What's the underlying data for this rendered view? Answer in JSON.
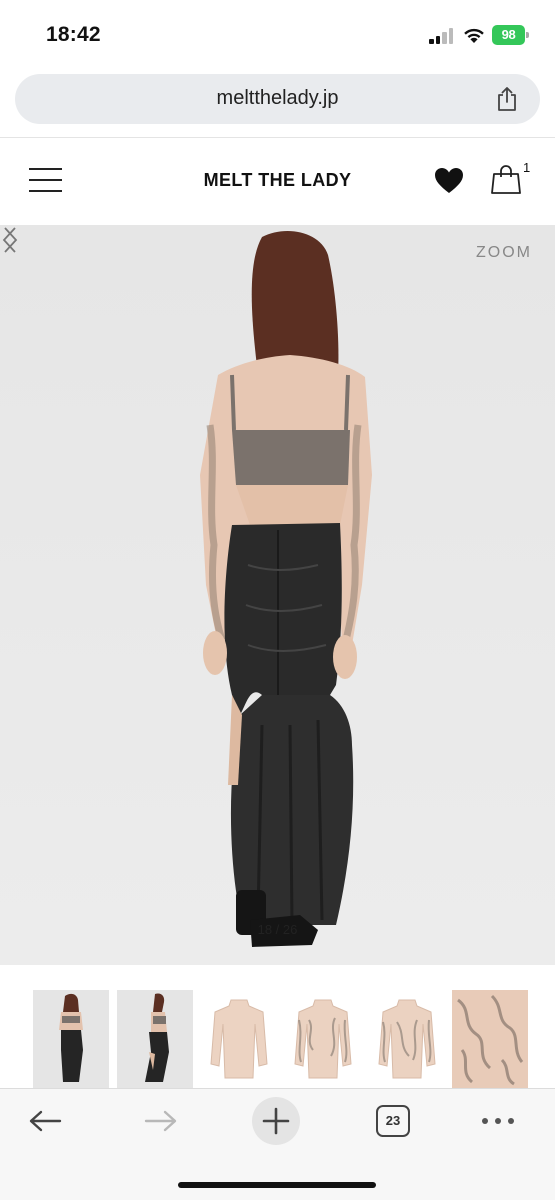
{
  "status_bar": {
    "time": "18:42",
    "battery": "98",
    "battery_color": "#34c759"
  },
  "browser": {
    "url": "meltthelady.jp",
    "share_icon": "share-icon",
    "tab_count": "23",
    "toolbar_icons": [
      "back-arrow-icon",
      "forward-arrow-icon",
      "new-tab-plus-icon",
      "tabs-icon",
      "more-icon"
    ]
  },
  "site": {
    "brand": "MELT THE LADY",
    "cart_count": "1",
    "icons": [
      "hamburger-menu-icon",
      "heart-icon",
      "shopping-bag-icon"
    ]
  },
  "gallery": {
    "zoom_label": "ZOOM",
    "counter": "18 / 26",
    "prev_icon": "chevron-left-icon",
    "next_icon": "chevron-right-icon",
    "image_subject": "model wearing sheer beige tattoo-print top, grey bra top and black ruched mermaid skirt, back view"
  },
  "thumbnails": [
    {
      "name": "thumb-model-back"
    },
    {
      "name": "thumb-model-side"
    },
    {
      "name": "thumb-top-plain"
    },
    {
      "name": "thumb-top-print-front"
    },
    {
      "name": "thumb-top-print-back"
    },
    {
      "name": "thumb-fabric-detail"
    }
  ]
}
